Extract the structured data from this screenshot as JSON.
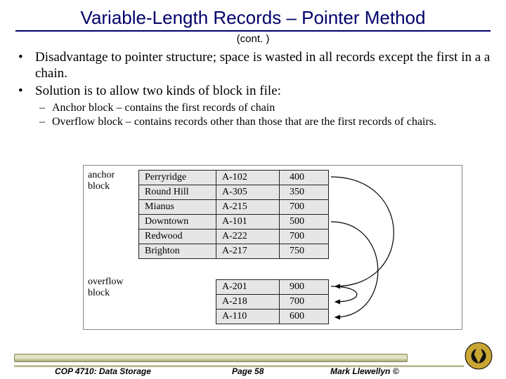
{
  "title": "Variable-Length Records – Pointer Method",
  "subtitle": "(cont. )",
  "bullets": {
    "b1a": "Disadvantage to pointer structure; space is wasted in all records except the first in a a chain.",
    "b1b": "Solution is to allow two kinds of block in file:",
    "b2a": "Anchor block – contains the first records of chain",
    "b2b": "Overflow block – contains records other than those that are the first records of chairs."
  },
  "labels": {
    "anchor": "anchor\nblock",
    "overflow": "overflow\nblock"
  },
  "anchor_table": [
    {
      "name": "Perryridge",
      "acct": "A-102",
      "bal": "400"
    },
    {
      "name": "Round Hill",
      "acct": "A-305",
      "bal": "350"
    },
    {
      "name": "Mianus",
      "acct": "A-215",
      "bal": "700"
    },
    {
      "name": "Downtown",
      "acct": "A-101",
      "bal": "500"
    },
    {
      "name": "Redwood",
      "acct": "A-222",
      "bal": "700"
    },
    {
      "name": "Brighton",
      "acct": "A-217",
      "bal": "750"
    }
  ],
  "overflow_table": [
    {
      "acct": "A-201",
      "bal": "900"
    },
    {
      "acct": "A-218",
      "bal": "700"
    },
    {
      "acct": "A-110",
      "bal": "600"
    }
  ],
  "footer": {
    "course": "COP 4710: Data Storage",
    "page": "Page 58",
    "author": "Mark Llewellyn ©"
  }
}
